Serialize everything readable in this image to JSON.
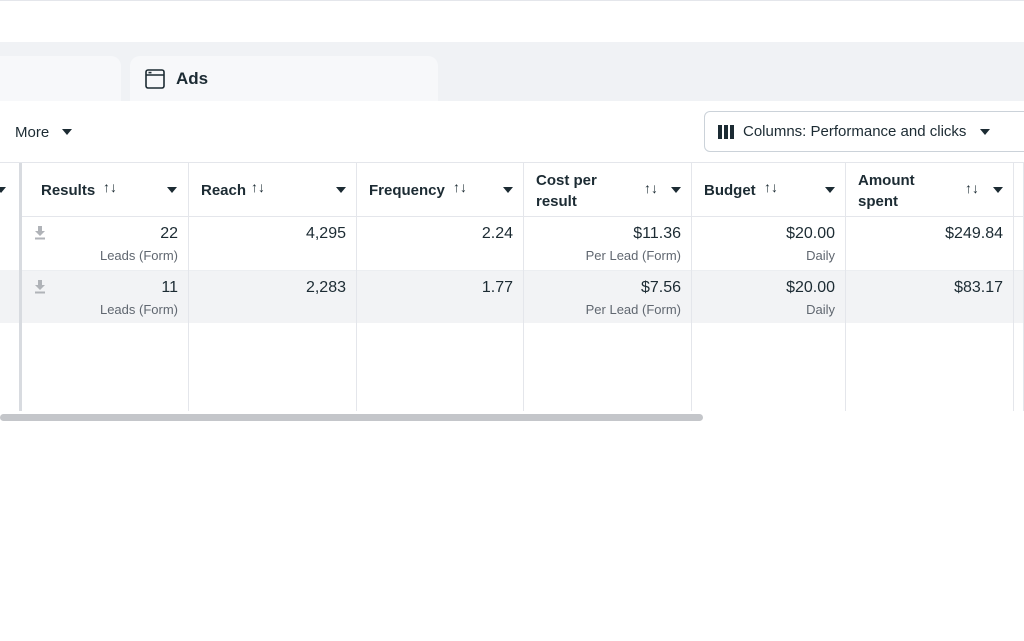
{
  "tabs": {
    "ads_label": "Ads"
  },
  "toolbar": {
    "more_label": "More",
    "columns_label": "Columns: Performance and clicks"
  },
  "table": {
    "columns": [
      {
        "key": "results",
        "header_l1": "Results",
        "header_l2": ""
      },
      {
        "key": "reach",
        "header_l1": "Reach",
        "header_l2": ""
      },
      {
        "key": "frequency",
        "header_l1": "Frequency",
        "header_l2": ""
      },
      {
        "key": "cost_per_result",
        "header_l1": "Cost per",
        "header_l2": "result"
      },
      {
        "key": "budget",
        "header_l1": "Budget",
        "header_l2": ""
      },
      {
        "key": "amount_spent",
        "header_l1": "Amount",
        "header_l2": "spent"
      }
    ],
    "rows": [
      {
        "results": "22",
        "results_sub": "Leads (Form)",
        "reach": "4,295",
        "frequency": "2.24",
        "cost_per_result": "$11.36",
        "cost_per_result_sub": "Per Lead (Form)",
        "budget": "$20.00",
        "budget_sub": "Daily",
        "amount_spent": "$249.84"
      },
      {
        "results": "11",
        "results_sub": "Leads (Form)",
        "reach": "2,283",
        "frequency": "1.77",
        "cost_per_result": "$7.56",
        "cost_per_result_sub": "Per Lead (Form)",
        "budget": "$20.00",
        "budget_sub": "Daily",
        "amount_spent": "$83.17"
      }
    ]
  },
  "colors": {
    "text": "#1c2b33",
    "muted": "#606770",
    "tab_bg": "#f0f2f5",
    "row_alt": "#f2f3f5",
    "border": "#e4e6eb"
  },
  "icons": {
    "tab": "ad-window-icon",
    "columns": "columns-icon",
    "sort": "sort-arrows-icon",
    "download": "download-icon",
    "caret": "caret-down-icon"
  }
}
